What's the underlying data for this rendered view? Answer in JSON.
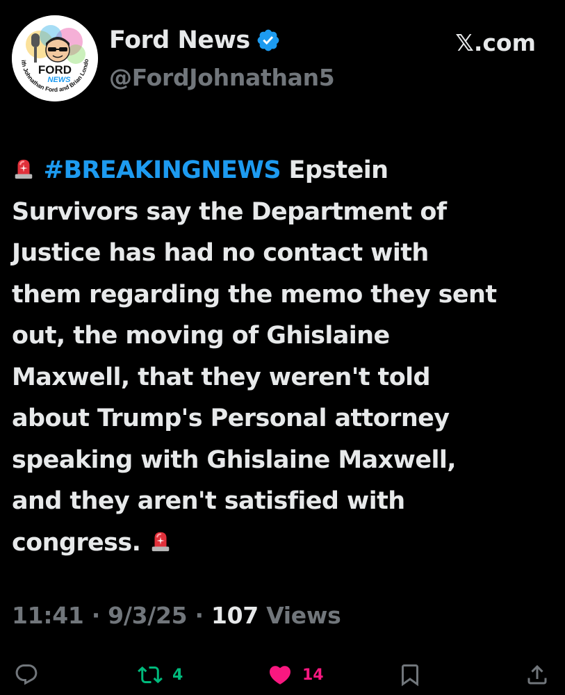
{
  "profile": {
    "display_name": "Ford News",
    "handle": "@FordJohnathan5",
    "avatar_title": "FORD",
    "avatar_subtitle": "NEWS",
    "avatar_ring_text": "with Johnathan Ford and Brian London",
    "verified": true
  },
  "source_label": "𝕏.com",
  "tweet": {
    "hashtag": "#BREAKINGNEWS",
    "line1_rest": " Epstein",
    "lines": [
      "Survivors say the Department of",
      "Justice has had no contact with",
      "them regarding the memo they sent",
      "out, the moving of Ghislaine",
      "Maxwell, that they weren't told",
      "about Trump's Personal attorney",
      "speaking with Ghislaine Maxwell,",
      "and they aren't satisfied with"
    ],
    "last_line": "congress. "
  },
  "meta": {
    "time": "11:41",
    "sep1": " · ",
    "date": "9/3/25",
    "sep2": " · ",
    "views_count": "107",
    "views_label": " Views"
  },
  "actions": {
    "repost_count": "4",
    "like_count": "14"
  },
  "colors": {
    "background": "#000000",
    "text": "#e7e9ea",
    "secondary": "#71767b",
    "link": "#1d9bf0",
    "repost": "#00ba7c",
    "like": "#f91880"
  }
}
